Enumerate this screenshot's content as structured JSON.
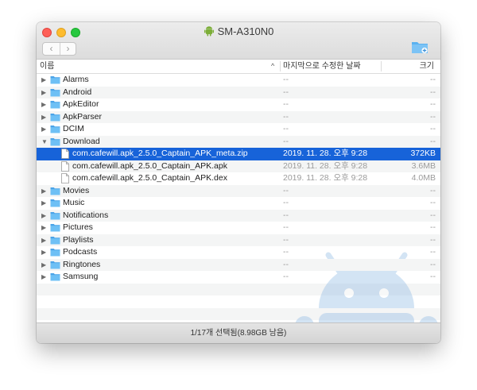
{
  "window": {
    "title": "SM-A310N0"
  },
  "toolbar": {
    "back_glyph": "‹",
    "forward_glyph": "›"
  },
  "columns": {
    "name": "이름",
    "sort_indicator": "^",
    "modified": "마지막으로 수정한 날짜",
    "size": "크기"
  },
  "rows": [
    {
      "type": "folder",
      "name": "Alarms",
      "date": "--",
      "size": "--",
      "expanded": false
    },
    {
      "type": "folder",
      "name": "Android",
      "date": "--",
      "size": "--",
      "expanded": false
    },
    {
      "type": "folder",
      "name": "ApkEditor",
      "date": "--",
      "size": "--",
      "expanded": false
    },
    {
      "type": "folder",
      "name": "ApkParser",
      "date": "--",
      "size": "--",
      "expanded": false
    },
    {
      "type": "folder",
      "name": "DCIM",
      "date": "--",
      "size": "--",
      "expanded": false
    },
    {
      "type": "folder",
      "name": "Download",
      "date": "--",
      "size": "--",
      "expanded": true
    },
    {
      "type": "file",
      "name": "com.cafewill.apk_2.5.0_Captain_APK_meta.zip",
      "date": "2019. 11. 28. 오후 9:28",
      "size": "372KB",
      "selected": true
    },
    {
      "type": "file",
      "name": "com.cafewill.apk_2.5.0_Captain_APK.apk",
      "date": "2019. 11. 28. 오후 9:28",
      "size": "3.6MB"
    },
    {
      "type": "file",
      "name": "com.cafewill.apk_2.5.0_Captain_APK.dex",
      "date": "2019. 11. 28. 오후 9:28",
      "size": "4.0MB"
    },
    {
      "type": "folder",
      "name": "Movies",
      "date": "--",
      "size": "--",
      "expanded": false
    },
    {
      "type": "folder",
      "name": "Music",
      "date": "--",
      "size": "--",
      "expanded": false
    },
    {
      "type": "folder",
      "name": "Notifications",
      "date": "--",
      "size": "--",
      "expanded": false
    },
    {
      "type": "folder",
      "name": "Pictures",
      "date": "--",
      "size": "--",
      "expanded": false
    },
    {
      "type": "folder",
      "name": "Playlists",
      "date": "--",
      "size": "--",
      "expanded": false
    },
    {
      "type": "folder",
      "name": "Podcasts",
      "date": "--",
      "size": "--",
      "expanded": false
    },
    {
      "type": "folder",
      "name": "Ringtones",
      "date": "--",
      "size": "--",
      "expanded": false
    },
    {
      "type": "folder",
      "name": "Samsung",
      "date": "--",
      "size": "--",
      "expanded": false
    }
  ],
  "status": {
    "text": "1/17개 선택됨(8.98GB 남음)"
  },
  "colors": {
    "selection": "#1763d9",
    "folder": "#5bb2f0",
    "android": "#a4c639"
  }
}
